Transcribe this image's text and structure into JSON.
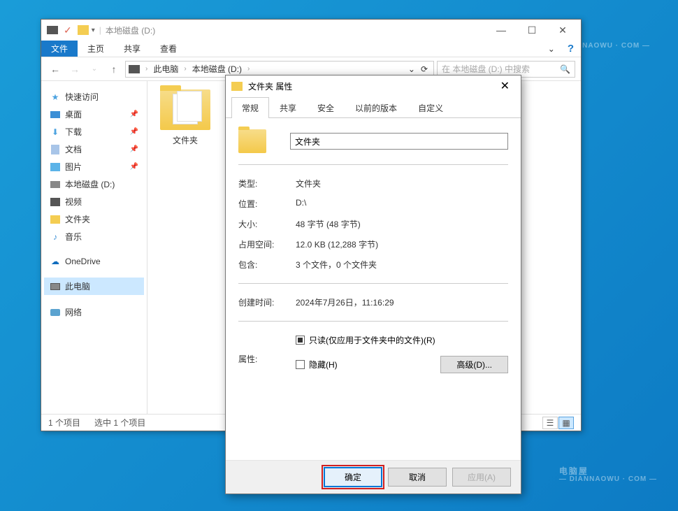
{
  "watermark": {
    "main": "电脑屋",
    "sub": "— DIANNAOWU · COM —"
  },
  "explorer": {
    "title": "本地磁盘 (D:)",
    "ribbon": {
      "file": "文件",
      "tabs": [
        "主页",
        "共享",
        "查看"
      ]
    },
    "breadcrumb": {
      "pc": "此电脑",
      "drive": "本地磁盘 (D:)"
    },
    "search_placeholder": "在 本地磁盘 (D:) 中搜索",
    "sidebar": {
      "quick": {
        "label": "快速访问",
        "items": [
          "桌面",
          "下载",
          "文档",
          "图片",
          "本地磁盘 (D:)",
          "视频",
          "文件夹",
          "音乐"
        ]
      },
      "onedrive": "OneDrive",
      "thispc": "此电脑",
      "network": "网络"
    },
    "content": {
      "folder_name": "文件夹"
    },
    "status": {
      "count": "1 个项目",
      "selected": "选中 1 个项目"
    }
  },
  "props": {
    "title": "文件夹 属性",
    "tabs": [
      "常规",
      "共享",
      "安全",
      "以前的版本",
      "自定义"
    ],
    "name": "文件夹",
    "rows": {
      "type_l": "类型:",
      "type_v": "文件夹",
      "loc_l": "位置:",
      "loc_v": "D:\\",
      "size_l": "大小:",
      "size_v": "48 字节 (48 字节)",
      "disk_l": "占用空间:",
      "disk_v": "12.0 KB (12,288 字节)",
      "cont_l": "包含:",
      "cont_v": "3 个文件，0 个文件夹",
      "ctime_l": "创建时间:",
      "ctime_v": "2024年7月26日，11:16:29",
      "attr_l": "属性:",
      "readonly": "只读(仅应用于文件夹中的文件)(R)",
      "hidden": "隐藏(H)",
      "advanced": "高级(D)..."
    },
    "buttons": {
      "ok": "确定",
      "cancel": "取消",
      "apply": "应用(A)"
    }
  }
}
